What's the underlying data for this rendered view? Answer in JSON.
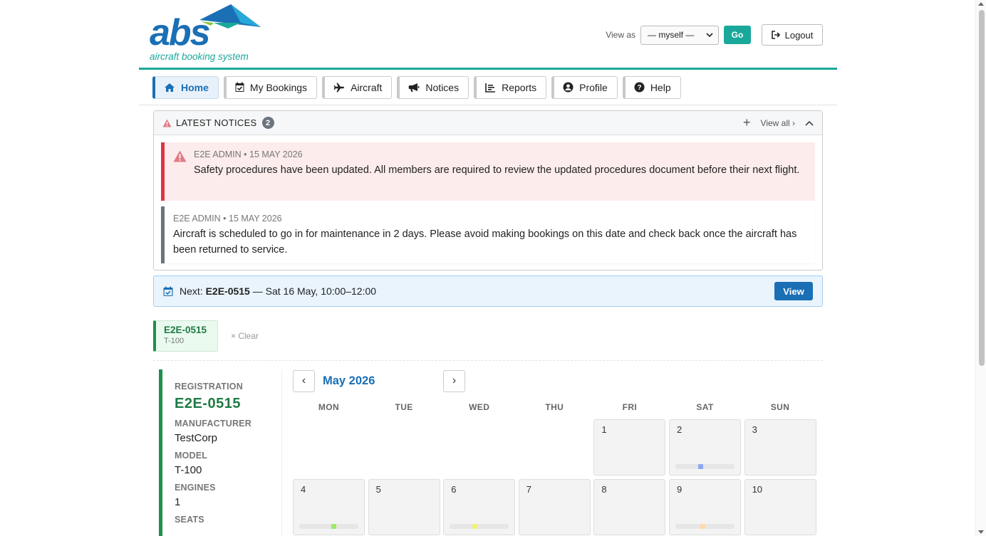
{
  "logo": {
    "text": "abs",
    "subtitle": "aircraft booking system"
  },
  "header": {
    "view_as_label": "View as",
    "view_as_value": "— myself —",
    "go_label": "Go",
    "logout_label": "Logout"
  },
  "nav": [
    {
      "label": "Home",
      "icon": "home-icon"
    },
    {
      "label": "My Bookings",
      "icon": "calendar-check-icon"
    },
    {
      "label": "Aircraft",
      "icon": "plane-icon"
    },
    {
      "label": "Notices",
      "icon": "megaphone-icon"
    },
    {
      "label": "Reports",
      "icon": "chart-icon"
    },
    {
      "label": "Profile",
      "icon": "user-circle-icon"
    },
    {
      "label": "Help",
      "icon": "question-circle-icon"
    }
  ],
  "notices": {
    "title": "LATEST NOTICES",
    "count": "2",
    "add_label": "+",
    "view_all_label": "View all ›",
    "items": [
      {
        "meta": "E2E ADMIN • 15 MAY 2026",
        "text": "Safety procedures have been updated. All members are required to review the updated procedures document before their next flight.",
        "level": "danger"
      },
      {
        "meta": "E2E ADMIN • 15 MAY 2026",
        "text": "Aircraft is scheduled to go in for maintenance in 2 days. Please avoid making bookings on this date and check back once the aircraft has been returned to service.",
        "level": "normal"
      }
    ]
  },
  "next_booking": {
    "prefix": "Next:",
    "registration": "E2E-0515",
    "when": "— Sat 16 May, 10:00–12:00",
    "view_label": "View"
  },
  "aircraft_chip": {
    "registration": "E2E-0515",
    "model": "T-100",
    "clear_label": "× Clear"
  },
  "aircraft_details": {
    "registration_label": "REGISTRATION",
    "registration": "E2E-0515",
    "manufacturer_label": "MANUFACTURER",
    "manufacturer": "TestCorp",
    "model_label": "MODEL",
    "model": "T-100",
    "engines_label": "ENGINES",
    "engines": "1",
    "seats_label": "SEATS"
  },
  "calendar": {
    "prev_label": "‹",
    "next_label": "›",
    "month": "May 2026",
    "weekdays": [
      "MON",
      "TUE",
      "WED",
      "THU",
      "FRI",
      "SAT",
      "SUN"
    ],
    "leading_blanks": 4,
    "visible_days": [
      {
        "day": "1"
      },
      {
        "day": "2",
        "booking_color": "#8fa8f5",
        "booking_position": 0.42
      },
      {
        "day": "3"
      },
      {
        "day": "4",
        "booking_color": "#9ee86b",
        "booking_position": 0.58
      },
      {
        "day": "5"
      },
      {
        "day": "6",
        "booking_color": "#f2f07a",
        "booking_position": 0.42
      },
      {
        "day": "7"
      },
      {
        "day": "8"
      },
      {
        "day": "9",
        "booking_color": "#ffd9a8",
        "booking_position": 0.46
      },
      {
        "day": "10"
      }
    ]
  },
  "colors": {
    "brand_blue": "#1a6fb5",
    "brand_teal": "#1aa89a",
    "danger": "#dc3545",
    "aircraft_green": "#1f8f4e"
  }
}
